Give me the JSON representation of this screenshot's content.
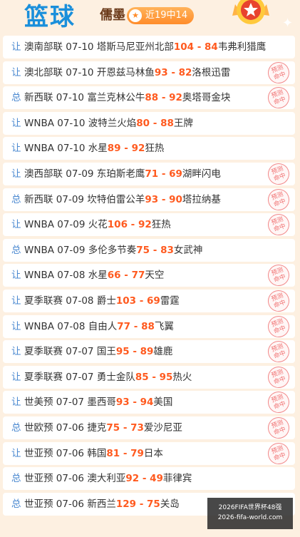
{
  "header": {
    "title": "篮球",
    "expert_name": "儒墨",
    "streak_label": "近19中14"
  },
  "stamp_text": [
    "预测",
    "命中"
  ],
  "rows": [
    {
      "type": "让",
      "league": "澳南部联",
      "date": "07-10",
      "home": "塔斯马尼亚州北部",
      "score": "104 - 84",
      "away": "韦弗利猎鹰",
      "hit": false
    },
    {
      "type": "让",
      "league": "澳北部联",
      "date": "07-10",
      "home": "开恩兹马林鱼",
      "score": "93 - 82",
      "away": "洛根迅雷",
      "hit": true
    },
    {
      "type": "总",
      "league": "新西联",
      "date": "07-10",
      "home": "富兰克林公牛",
      "score": "88 - 92",
      "away": "奥塔哥金块",
      "hit": true
    },
    {
      "type": "让",
      "league": "WNBA",
      "date": "07-10",
      "home": "波特兰火焰",
      "score": "80 - 88",
      "away": "王牌",
      "hit": false
    },
    {
      "type": "让",
      "league": "WNBA",
      "date": "07-10",
      "home": "水星",
      "score": "89 - 92",
      "away": "狂热",
      "hit": false
    },
    {
      "type": "让",
      "league": "澳西部联",
      "date": "07-09",
      "home": "东珀斯老鹰",
      "score": "71 - 69",
      "away": "湖畔闪电",
      "hit": true
    },
    {
      "type": "总",
      "league": "新西联",
      "date": "07-09",
      "home": "坎特伯雷公羊",
      "score": "93 - 90",
      "away": "塔拉纳基",
      "hit": true
    },
    {
      "type": "让",
      "league": "WNBA",
      "date": "07-09",
      "home": "火花",
      "score": "106 - 92",
      "away": "狂热",
      "hit": true
    },
    {
      "type": "总",
      "league": "WNBA",
      "date": "07-09",
      "home": "多伦多节奏",
      "score": "75 - 83",
      "away": "女武神",
      "hit": false
    },
    {
      "type": "让",
      "league": "WNBA",
      "date": "07-08",
      "home": "水星",
      "score": "66 - 77",
      "away": "天空",
      "hit": true
    },
    {
      "type": "让",
      "league": "夏季联赛",
      "date": "07-08",
      "home": "爵士",
      "score": "103 - 69",
      "away": "雷霆",
      "hit": true
    },
    {
      "type": "让",
      "league": "WNBA",
      "date": "07-08",
      "home": "自由人",
      "score": "77 - 88",
      "away": "飞翼",
      "hit": true
    },
    {
      "type": "让",
      "league": "夏季联赛",
      "date": "07-07",
      "home": "国王",
      "score": "95 - 89",
      "away": "雄鹿",
      "hit": true
    },
    {
      "type": "让",
      "league": "夏季联赛",
      "date": "07-07",
      "home": "勇士金队",
      "score": "85 - 95",
      "away": "热火",
      "hit": true
    },
    {
      "type": "让",
      "league": "世美预",
      "date": "07-07",
      "home": "墨西哥",
      "score": "93 - 94",
      "away": "美国",
      "hit": true
    },
    {
      "type": "总",
      "league": "世欧预",
      "date": "07-06",
      "home": "捷克",
      "score": "75 - 73",
      "away": "爱沙尼亚",
      "hit": true
    },
    {
      "type": "让",
      "league": "世亚预",
      "date": "07-06",
      "home": "韩国",
      "score": "81 - 79",
      "away": "日本",
      "hit": true
    },
    {
      "type": "总",
      "league": "世亚预",
      "date": "07-06",
      "home": "澳大利亚",
      "score": "92 - 49",
      "away": "菲律宾",
      "hit": false
    },
    {
      "type": "总",
      "league": "世亚预",
      "date": "07-06",
      "home": "新西兰",
      "score": "129 - 75",
      "away": "关岛",
      "hit": false
    }
  ],
  "watermark": [
    "2026FIFA世界杯48强",
    "2026-fifa-world.com"
  ]
}
